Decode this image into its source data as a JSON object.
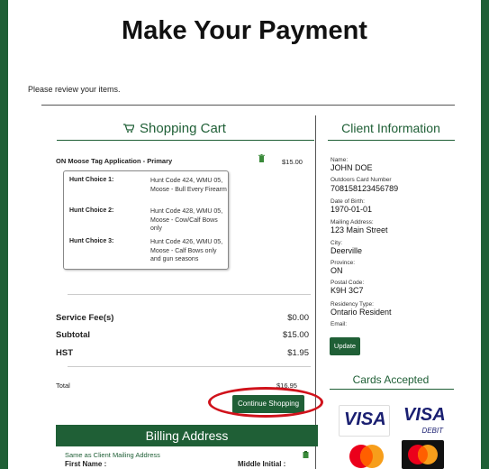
{
  "page": {
    "title": "Make Your Payment",
    "review_text": "Please review your items."
  },
  "cart": {
    "title": "Shopping Cart",
    "item": {
      "name": "ON Moose Tag Application - Primary",
      "price": "$15.00"
    },
    "choices": [
      {
        "label": "Hunt Choice 1:",
        "text": "Hunt Code 424, WMU 05, Moose - Bull Every Firearm"
      },
      {
        "label": "Hunt Choice 2:",
        "text": "Hunt Code 428, WMU 05, Moose - Cow/Calf Bows only"
      },
      {
        "label": "Hunt Choice 3:",
        "text": "Hunt Code 426, WMU 05, Moose - Calf Bows only and gun seasons"
      }
    ],
    "service_fee_label": "Service Fee(s)",
    "service_fee": "$0.00",
    "subtotal_label": "Subtotal",
    "subtotal": "$15.00",
    "hst_label": "HST",
    "hst": "$1.95",
    "total_label": "Total",
    "total": "$16.95",
    "continue_label": "Continue Shopping"
  },
  "billing": {
    "title": "Billing Address",
    "same_as": "Same as Client Mailing Address",
    "first_name_label": "First Name :",
    "middle_initial_label": "Middle Initial :"
  },
  "client": {
    "title": "Client Information",
    "name_label": "Name:",
    "name": "JOHN DOE",
    "card_label": "Outdoors Card Number",
    "card": "708158123456789",
    "dob_label": "Date of Birth:",
    "dob": "1970-01-01",
    "address_label": "Mailing Address:",
    "address": "123 Main Street",
    "city_label": "City:",
    "city": "Deerville",
    "province_label": "Province:",
    "province": "ON",
    "postal_label": "Postal Code:",
    "postal": "K9H 3C7",
    "residency_label": "Residency Type:",
    "residency": "Ontario Resident",
    "email_label": "Email:",
    "update_label": "Update"
  },
  "cards": {
    "title": "Cards Accepted",
    "visa": "VISA",
    "visa_debit": "VISA",
    "debit": "DEBIT"
  },
  "colors": {
    "brand": "#1f5f36",
    "highlight": "#d0121b"
  }
}
